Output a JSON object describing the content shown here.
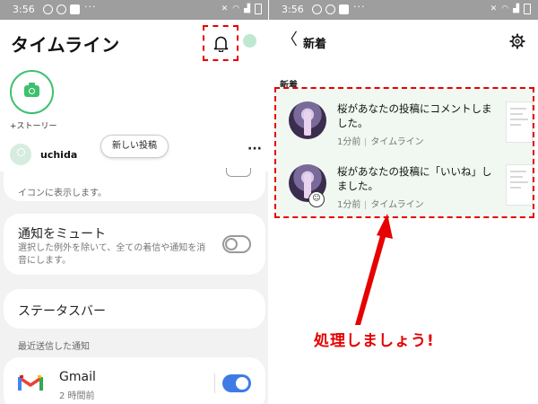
{
  "left_screen": {
    "status_bar": {
      "time": "3:56",
      "overflow": "···"
    },
    "header": {
      "title": "タイムライン",
      "bell_icon": "bell-icon"
    },
    "story": {
      "label": "+ストーリー",
      "icon": "camera-icon"
    },
    "user": {
      "name": "uchida",
      "new_post_label": "新しい投稿",
      "more_label": "···"
    },
    "settings": {
      "partial_desc_faded": "",
      "partial_desc": "イコンに表示します。",
      "mute": {
        "title": "通知をミュート",
        "desc": "選択した例外を除いて、全ての着信や通知を消音にします。",
        "enabled": false
      },
      "status_bar_item": {
        "title": "ステータスバー"
      },
      "recent_label": "最近送信した通知",
      "gmail": {
        "title": "Gmail",
        "subtitle": "2 時間前",
        "enabled": true
      }
    }
  },
  "right_screen": {
    "status_bar": {
      "time": "3:56",
      "overflow": "···"
    },
    "header": {
      "back_label": "〈",
      "title": "新着",
      "gear_icon": "gear-icon"
    },
    "section_label": "新着",
    "notifications": [
      {
        "text": "桜があなたの投稿にコメントしました。",
        "time": "1分前",
        "source": "タイムライン"
      },
      {
        "text": "桜があなたの投稿に「いいね」しました。",
        "time": "1分前",
        "source": "タイムライン"
      }
    ]
  },
  "annotation": {
    "callout": "処理しましょう!",
    "highlight_color": "#e60000"
  },
  "colors": {
    "accent_green": "#3cc16e",
    "toggle_blue": "#3e7be6",
    "notif_bg": "#f0f8f1"
  }
}
